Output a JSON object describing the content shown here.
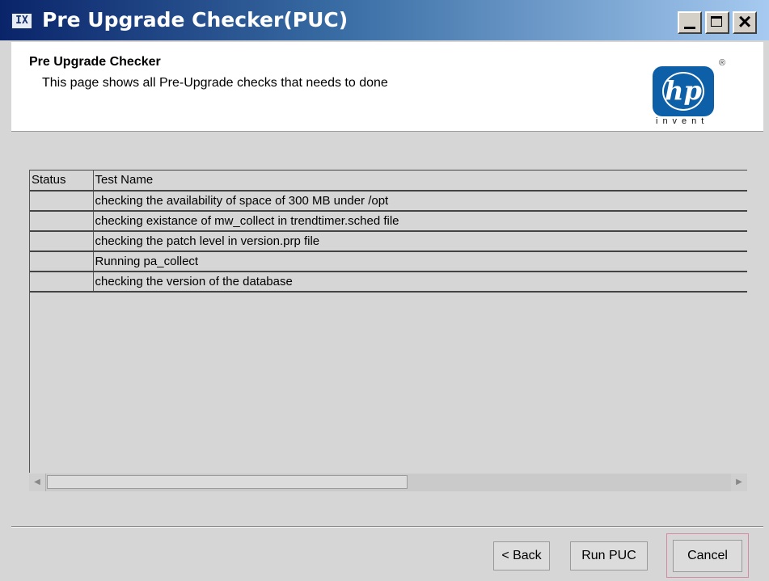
{
  "window": {
    "title": "Pre Upgrade Checker(PUC)",
    "app_icon": "puc-app-icon",
    "controls": [
      "minimize-icon",
      "maximize-icon",
      "close-icon"
    ]
  },
  "header": {
    "title": "Pre Upgrade Checker",
    "description": "This page shows all Pre-Upgrade checks that needs to done",
    "logo": {
      "mark": "hp",
      "registered": "®",
      "tagline": "invent",
      "color": "#0d5fa8"
    }
  },
  "table": {
    "columns": [
      "Status",
      "Test Name"
    ],
    "rows": [
      {
        "status": "",
        "test_name": "checking the availability of space of 300 MB under /opt"
      },
      {
        "status": "",
        "test_name": "checking existance of mw_collect in trendtimer.sched file"
      },
      {
        "status": "",
        "test_name": "checking the patch level in version.prp file"
      },
      {
        "status": "",
        "test_name": "Running pa_collect"
      },
      {
        "status": "",
        "test_name": "checking the version of the database"
      }
    ]
  },
  "buttons": {
    "back": "< Back",
    "run": "Run PUC",
    "cancel": "Cancel"
  }
}
